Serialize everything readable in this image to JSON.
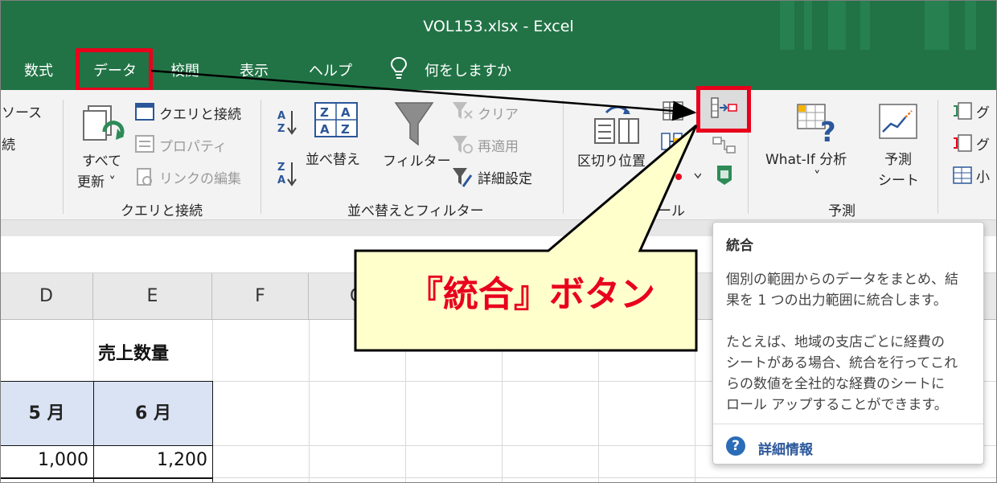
{
  "window": {
    "title": "VOL153.xlsx  -  Excel"
  },
  "tabs": [
    {
      "label": "数式"
    },
    {
      "label": "データ"
    },
    {
      "label": "校閲"
    },
    {
      "label": "表示"
    },
    {
      "label": "ヘルプ"
    },
    {
      "label": "何をしますか"
    }
  ],
  "ribbon": {
    "get_data": {
      "source_fragment": "ソース",
      "line2_fragment": "続"
    },
    "queries": {
      "refresh_all_line1": "すべて",
      "refresh_all_line2": "更新 ˅",
      "queries_connections": "クエリと接続",
      "properties": "プロパティ",
      "edit_links": "リンクの編集",
      "group_label": "クエリと接続"
    },
    "sort_filter": {
      "sort": "並べ替え",
      "filter": "フィルター",
      "clear": "クリア",
      "reapply": "再適用",
      "advanced": "詳細設定",
      "group_label": "並べ替えとフィルター"
    },
    "data_tools": {
      "text_to_columns": "区切り位置",
      "group_label_fragment": "ール"
    },
    "forecast": {
      "what_if": "What-If 分析",
      "what_if_caret": "˅",
      "forecast_sheet_line1": "予測",
      "forecast_sheet_line2": "シート",
      "group_label": "予測"
    },
    "outline": {
      "item1": "グ",
      "item2": "グ",
      "item3": "小"
    }
  },
  "grid": {
    "columns": [
      "D",
      "E",
      "F",
      "G"
    ],
    "title_cell": "売上数量",
    "header_cells": [
      "5 月",
      "6 月"
    ],
    "values": [
      "1,000",
      "1,200"
    ]
  },
  "callout": {
    "text": "『統合』ボタン"
  },
  "tooltip": {
    "title": "統合",
    "lines": [
      "個別の範囲からのデータをまとめ、結",
      "果を 1 つの出力範囲に統合します。",
      "たとえば、地域の支店ごとに経費の",
      "シートがある場合、統合を行ってこれ",
      "らの数値を全社的な経費のシートに",
      "ロール アップすることができます。"
    ],
    "help_icon": "?",
    "more_info": "詳細情報"
  },
  "colors": {
    "excel_green": "#217346",
    "highlight_red": "#e8001c",
    "callout_fill": "#ffffcc",
    "table_header_fill": "#dae3f3"
  },
  "icons": [
    "lightbulb-icon",
    "refresh-icon",
    "sort-az-icon",
    "sort-za-icon",
    "filter-icon",
    "consolidate-icon",
    "what-if-icon",
    "forecast-sheet-icon",
    "help-icon"
  ]
}
